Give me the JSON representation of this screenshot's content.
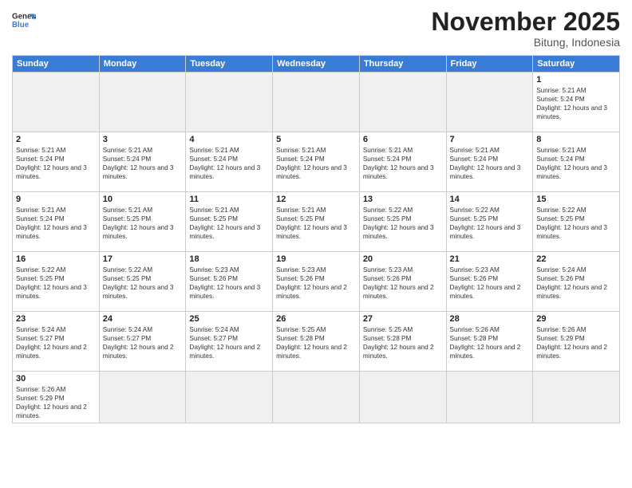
{
  "header": {
    "logo_general": "General",
    "logo_blue": "Blue",
    "month_title": "November 2025",
    "location": "Bitung, Indonesia"
  },
  "days": [
    "Sunday",
    "Monday",
    "Tuesday",
    "Wednesday",
    "Thursday",
    "Friday",
    "Saturday"
  ],
  "weeks": [
    [
      {
        "date": "",
        "empty": true
      },
      {
        "date": "",
        "empty": true
      },
      {
        "date": "",
        "empty": true
      },
      {
        "date": "",
        "empty": true
      },
      {
        "date": "",
        "empty": true
      },
      {
        "date": "",
        "empty": true
      },
      {
        "date": "1",
        "sunrise": "5:21 AM",
        "sunset": "5:24 PM",
        "daylight": "12 hours and 3 minutes."
      }
    ],
    [
      {
        "date": "2",
        "sunrise": "5:21 AM",
        "sunset": "5:24 PM",
        "daylight": "12 hours and 3 minutes."
      },
      {
        "date": "3",
        "sunrise": "5:21 AM",
        "sunset": "5:24 PM",
        "daylight": "12 hours and 3 minutes."
      },
      {
        "date": "4",
        "sunrise": "5:21 AM",
        "sunset": "5:24 PM",
        "daylight": "12 hours and 3 minutes."
      },
      {
        "date": "5",
        "sunrise": "5:21 AM",
        "sunset": "5:24 PM",
        "daylight": "12 hours and 3 minutes."
      },
      {
        "date": "6",
        "sunrise": "5:21 AM",
        "sunset": "5:24 PM",
        "daylight": "12 hours and 3 minutes."
      },
      {
        "date": "7",
        "sunrise": "5:21 AM",
        "sunset": "5:24 PM",
        "daylight": "12 hours and 3 minutes."
      },
      {
        "date": "8",
        "sunrise": "5:21 AM",
        "sunset": "5:24 PM",
        "daylight": "12 hours and 3 minutes."
      }
    ],
    [
      {
        "date": "9",
        "sunrise": "5:21 AM",
        "sunset": "5:24 PM",
        "daylight": "12 hours and 3 minutes."
      },
      {
        "date": "10",
        "sunrise": "5:21 AM",
        "sunset": "5:25 PM",
        "daylight": "12 hours and 3 minutes."
      },
      {
        "date": "11",
        "sunrise": "5:21 AM",
        "sunset": "5:25 PM",
        "daylight": "12 hours and 3 minutes."
      },
      {
        "date": "12",
        "sunrise": "5:21 AM",
        "sunset": "5:25 PM",
        "daylight": "12 hours and 3 minutes."
      },
      {
        "date": "13",
        "sunrise": "5:22 AM",
        "sunset": "5:25 PM",
        "daylight": "12 hours and 3 minutes."
      },
      {
        "date": "14",
        "sunrise": "5:22 AM",
        "sunset": "5:25 PM",
        "daylight": "12 hours and 3 minutes."
      },
      {
        "date": "15",
        "sunrise": "5:22 AM",
        "sunset": "5:25 PM",
        "daylight": "12 hours and 3 minutes."
      }
    ],
    [
      {
        "date": "16",
        "sunrise": "5:22 AM",
        "sunset": "5:25 PM",
        "daylight": "12 hours and 3 minutes."
      },
      {
        "date": "17",
        "sunrise": "5:22 AM",
        "sunset": "5:25 PM",
        "daylight": "12 hours and 3 minutes."
      },
      {
        "date": "18",
        "sunrise": "5:23 AM",
        "sunset": "5:26 PM",
        "daylight": "12 hours and 3 minutes."
      },
      {
        "date": "19",
        "sunrise": "5:23 AM",
        "sunset": "5:26 PM",
        "daylight": "12 hours and 2 minutes."
      },
      {
        "date": "20",
        "sunrise": "5:23 AM",
        "sunset": "5:26 PM",
        "daylight": "12 hours and 2 minutes."
      },
      {
        "date": "21",
        "sunrise": "5:23 AM",
        "sunset": "5:26 PM",
        "daylight": "12 hours and 2 minutes."
      },
      {
        "date": "22",
        "sunrise": "5:24 AM",
        "sunset": "5:26 PM",
        "daylight": "12 hours and 2 minutes."
      }
    ],
    [
      {
        "date": "23",
        "sunrise": "5:24 AM",
        "sunset": "5:27 PM",
        "daylight": "12 hours and 2 minutes."
      },
      {
        "date": "24",
        "sunrise": "5:24 AM",
        "sunset": "5:27 PM",
        "daylight": "12 hours and 2 minutes."
      },
      {
        "date": "25",
        "sunrise": "5:24 AM",
        "sunset": "5:27 PM",
        "daylight": "12 hours and 2 minutes."
      },
      {
        "date": "26",
        "sunrise": "5:25 AM",
        "sunset": "5:28 PM",
        "daylight": "12 hours and 2 minutes."
      },
      {
        "date": "27",
        "sunrise": "5:25 AM",
        "sunset": "5:28 PM",
        "daylight": "12 hours and 2 minutes."
      },
      {
        "date": "28",
        "sunrise": "5:26 AM",
        "sunset": "5:28 PM",
        "daylight": "12 hours and 2 minutes."
      },
      {
        "date": "29",
        "sunrise": "5:26 AM",
        "sunset": "5:29 PM",
        "daylight": "12 hours and 2 minutes."
      }
    ],
    [
      {
        "date": "30",
        "sunrise": "5:26 AM",
        "sunset": "5:29 PM",
        "daylight": "12 hours and 2 minutes."
      },
      {
        "date": "",
        "empty": true
      },
      {
        "date": "",
        "empty": true
      },
      {
        "date": "",
        "empty": true
      },
      {
        "date": "",
        "empty": true
      },
      {
        "date": "",
        "empty": true
      },
      {
        "date": "",
        "empty": true
      }
    ]
  ]
}
